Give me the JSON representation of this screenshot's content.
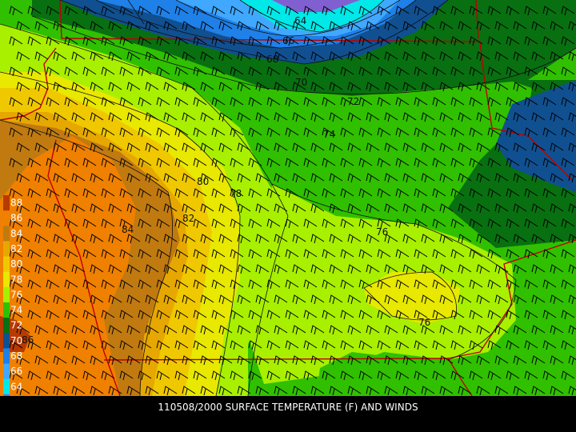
{
  "caption": "110508/2000 SURFACE TEMPERATURE (F) AND WINDS",
  "legend": {
    "entries": [
      {
        "value": "88",
        "color": "#b83a00"
      },
      {
        "value": "86",
        "color": "#f08000"
      },
      {
        "value": "84",
        "color": "#c07a10"
      },
      {
        "value": "82",
        "color": "#e6a800"
      },
      {
        "value": "80",
        "color": "#f0c800"
      },
      {
        "value": "78",
        "color": "#e8e800"
      },
      {
        "value": "76",
        "color": "#a8f000"
      },
      {
        "value": "74",
        "color": "#30c000"
      },
      {
        "value": "72",
        "color": "#087010"
      },
      {
        "value": "70",
        "color": "#105090"
      },
      {
        "value": "68",
        "color": "#1f80e8"
      },
      {
        "value": "66",
        "color": "#40a8ff"
      },
      {
        "value": "64",
        "color": "#00e8e8"
      },
      {
        "value": "62",
        "color": "#8060d0"
      }
    ]
  },
  "contour_labels": [
    "64",
    "66",
    "68",
    "70",
    "72",
    "74",
    "80",
    "78",
    "82",
    "84",
    "76",
    "76",
    "86"
  ],
  "colors": {
    "border": "#c00000",
    "contour": "#111111",
    "wind_barb": "#000000",
    "background": "#000000"
  }
}
